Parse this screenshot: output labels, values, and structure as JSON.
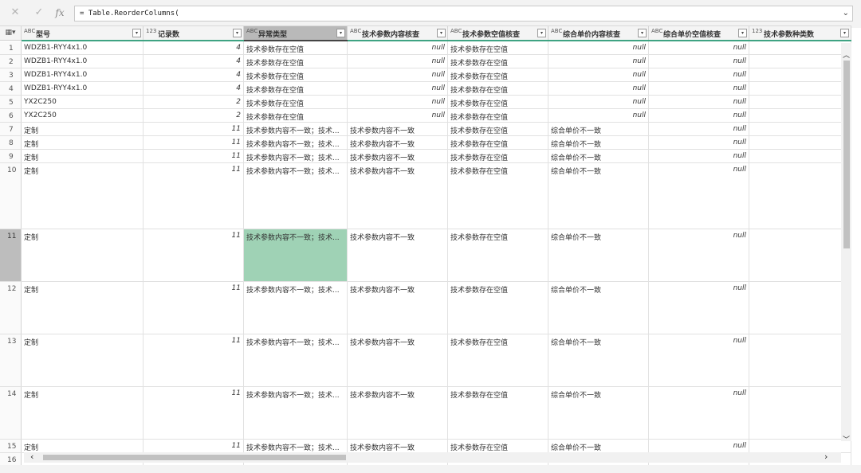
{
  "formula_bar": {
    "cancel_icon": "close-icon",
    "confirm_icon": "check-icon",
    "fx_label": "fx",
    "formula": "= Table.ReorderColumns(",
    "expand_icon": "chevron-down-icon"
  },
  "columns": [
    {
      "type": "ABC",
      "name": "型号"
    },
    {
      "type": "123",
      "name": "记录数"
    },
    {
      "type": "ABC",
      "name": "异常类型"
    },
    {
      "type": "ABC",
      "name": "技术参数内容核查"
    },
    {
      "type": "ABC",
      "name": "技术参数空值核查"
    },
    {
      "type": "ABC",
      "name": "综合单价内容核查"
    },
    {
      "type": "ABC",
      "name": "综合单价空值核查"
    },
    {
      "type": "123",
      "name": "技术参数种类数"
    }
  ],
  "rows": [
    {
      "n": "1",
      "c": [
        "WDZB1-RYY4x1.0",
        "4",
        "技术参数存在空值",
        "null",
        "技术参数存在空值",
        "null",
        "null",
        ""
      ]
    },
    {
      "n": "2",
      "c": [
        "WDZB1-RYY4x1.0",
        "4",
        "技术参数存在空值",
        "null",
        "技术参数存在空值",
        "null",
        "null",
        ""
      ]
    },
    {
      "n": "3",
      "c": [
        "WDZB1-RYY4x1.0",
        "4",
        "技术参数存在空值",
        "null",
        "技术参数存在空值",
        "null",
        "null",
        ""
      ]
    },
    {
      "n": "4",
      "c": [
        "WDZB1-RYY4x1.0",
        "4",
        "技术参数存在空值",
        "null",
        "技术参数存在空值",
        "null",
        "null",
        ""
      ]
    },
    {
      "n": "5",
      "c": [
        "YX2C250",
        "2",
        "技术参数存在空值",
        "null",
        "技术参数存在空值",
        "null",
        "null",
        ""
      ]
    },
    {
      "n": "6",
      "c": [
        "YX2C250",
        "2",
        "技术参数存在空值",
        "null",
        "技术参数存在空值",
        "null",
        "null",
        ""
      ]
    },
    {
      "n": "7",
      "c": [
        "定制",
        "11",
        "技术参数内容不一致；技术...",
        "技术参数内容不一致",
        "技术参数存在空值",
        "综合单价不一致",
        "null",
        ""
      ]
    },
    {
      "n": "8",
      "c": [
        "定制",
        "11",
        "技术参数内容不一致；技术...",
        "技术参数内容不一致",
        "技术参数存在空值",
        "综合单价不一致",
        "null",
        ""
      ]
    },
    {
      "n": "9",
      "c": [
        "定制",
        "11",
        "技术参数内容不一致；技术...",
        "技术参数内容不一致",
        "技术参数存在空值",
        "综合单价不一致",
        "null",
        ""
      ]
    },
    {
      "n": "10",
      "c": [
        "定制",
        "11",
        "技术参数内容不一致；技术...",
        "技术参数内容不一致",
        "技术参数存在空值",
        "综合单价不一致",
        "null",
        ""
      ]
    },
    {
      "n": "11",
      "c": [
        "定制",
        "11",
        "技术参数内容不一致；技术...",
        "技术参数内容不一致",
        "技术参数存在空值",
        "综合单价不一致",
        "null",
        ""
      ]
    },
    {
      "n": "12",
      "c": [
        "定制",
        "11",
        "技术参数内容不一致；技术...",
        "技术参数内容不一致",
        "技术参数存在空值",
        "综合单价不一致",
        "null",
        ""
      ]
    },
    {
      "n": "13",
      "c": [
        "定制",
        "11",
        "技术参数内容不一致；技术...",
        "技术参数内容不一致",
        "技术参数存在空值",
        "综合单价不一致",
        "null",
        ""
      ]
    },
    {
      "n": "14",
      "c": [
        "定制",
        "11",
        "技术参数内容不一致；技术...",
        "技术参数内容不一致",
        "技术参数存在空值",
        "综合单价不一致",
        "null",
        ""
      ]
    },
    {
      "n": "15",
      "c": [
        "定制",
        "11",
        "技术参数内容不一致；技术...",
        "技术参数内容不一致",
        "技术参数存在空值",
        "综合单价不一致",
        "null",
        ""
      ]
    },
    {
      "n": "16",
      "c": [
        "",
        "",
        "",
        "",
        "",
        "",
        "",
        ""
      ]
    }
  ],
  "selected_row": "11",
  "selected_column": "异常类型",
  "colors": {
    "highlight": "#9fd2b5",
    "quality_bar": "#3fa383"
  }
}
